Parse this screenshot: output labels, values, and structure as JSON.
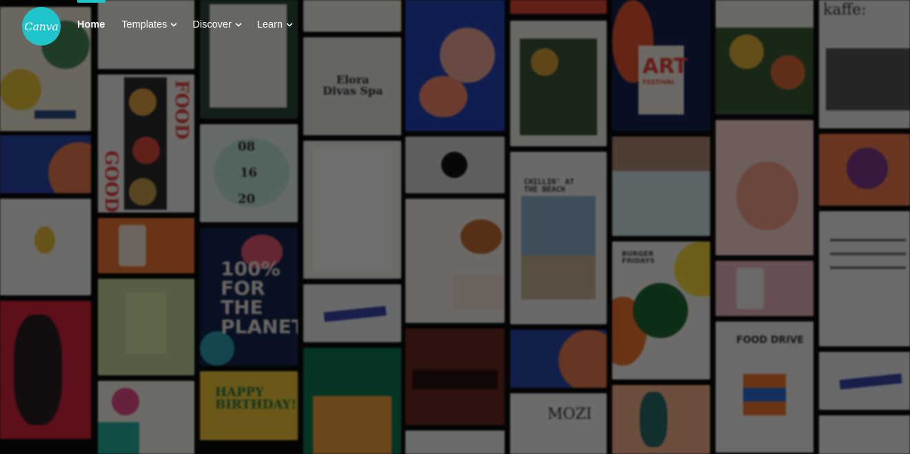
{
  "brand": {
    "logo_text": "Canva",
    "accent_color": "#20c4cb"
  },
  "nav": {
    "items": [
      {
        "label": "Home",
        "active": true,
        "has_dropdown": false
      },
      {
        "label": "Templates",
        "active": false,
        "has_dropdown": true,
        "icon": "chevron-down-icon"
      },
      {
        "label": "Discover",
        "active": false,
        "has_dropdown": true,
        "icon": "chevron-down-icon"
      },
      {
        "label": "Learn",
        "active": false,
        "has_dropdown": true,
        "icon": "chevron-down-icon"
      }
    ]
  },
  "background": {
    "tile_texts": {
      "food": "FOOD",
      "good": "GOOD",
      "art": "ART",
      "festival": "FESTIVAL",
      "elora": "Elora\nDivas Spa",
      "date1": "08",
      "date2": "16",
      "date3": "20",
      "planet": "100%\nFOR\nTHE\nPLANET",
      "burger": "BURGER\nFRIDAYS",
      "kaffe": "kaffe:",
      "mozi": "MOZI",
      "beach": "CHILLIN' AT\nTHE BEACH",
      "food_drive": "FOOD DRIVE",
      "birthday": "HAPPY\nBIRTHDAY!"
    }
  }
}
